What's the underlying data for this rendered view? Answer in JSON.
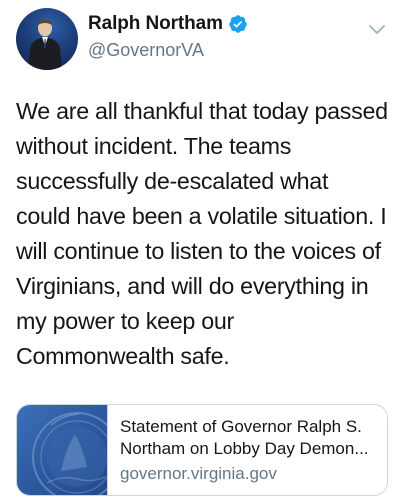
{
  "author": {
    "display_name": "Ralph Northam",
    "handle": "@GovernorVA",
    "verified": true,
    "avatar_icon": "portrait-avatar"
  },
  "tweet": {
    "text_lines": [
      "We are all thankful that today passed",
      "without incident. The teams",
      "successfully de-escalated what",
      "could have been a volatile situation. I",
      "will continue to listen to the voices of",
      "Virginians, and will do everything in",
      "my power to keep our",
      "Commonwealth safe."
    ]
  },
  "link_card": {
    "title_line1": "Statement of Governor Ralph S.",
    "title_line2": "Northam on Lobby Day Demon...",
    "domain": "governor.virginia.gov",
    "thumbnail_icon": "virginia-seal-thumbnail"
  },
  "icons": {
    "verified": "verified-badge-icon",
    "more": "chevron-down-icon"
  },
  "colors": {
    "text_primary": "#14171a",
    "text_secondary": "#657786",
    "verified_blue": "#1da1f2",
    "card_border": "#ccd6dd"
  }
}
